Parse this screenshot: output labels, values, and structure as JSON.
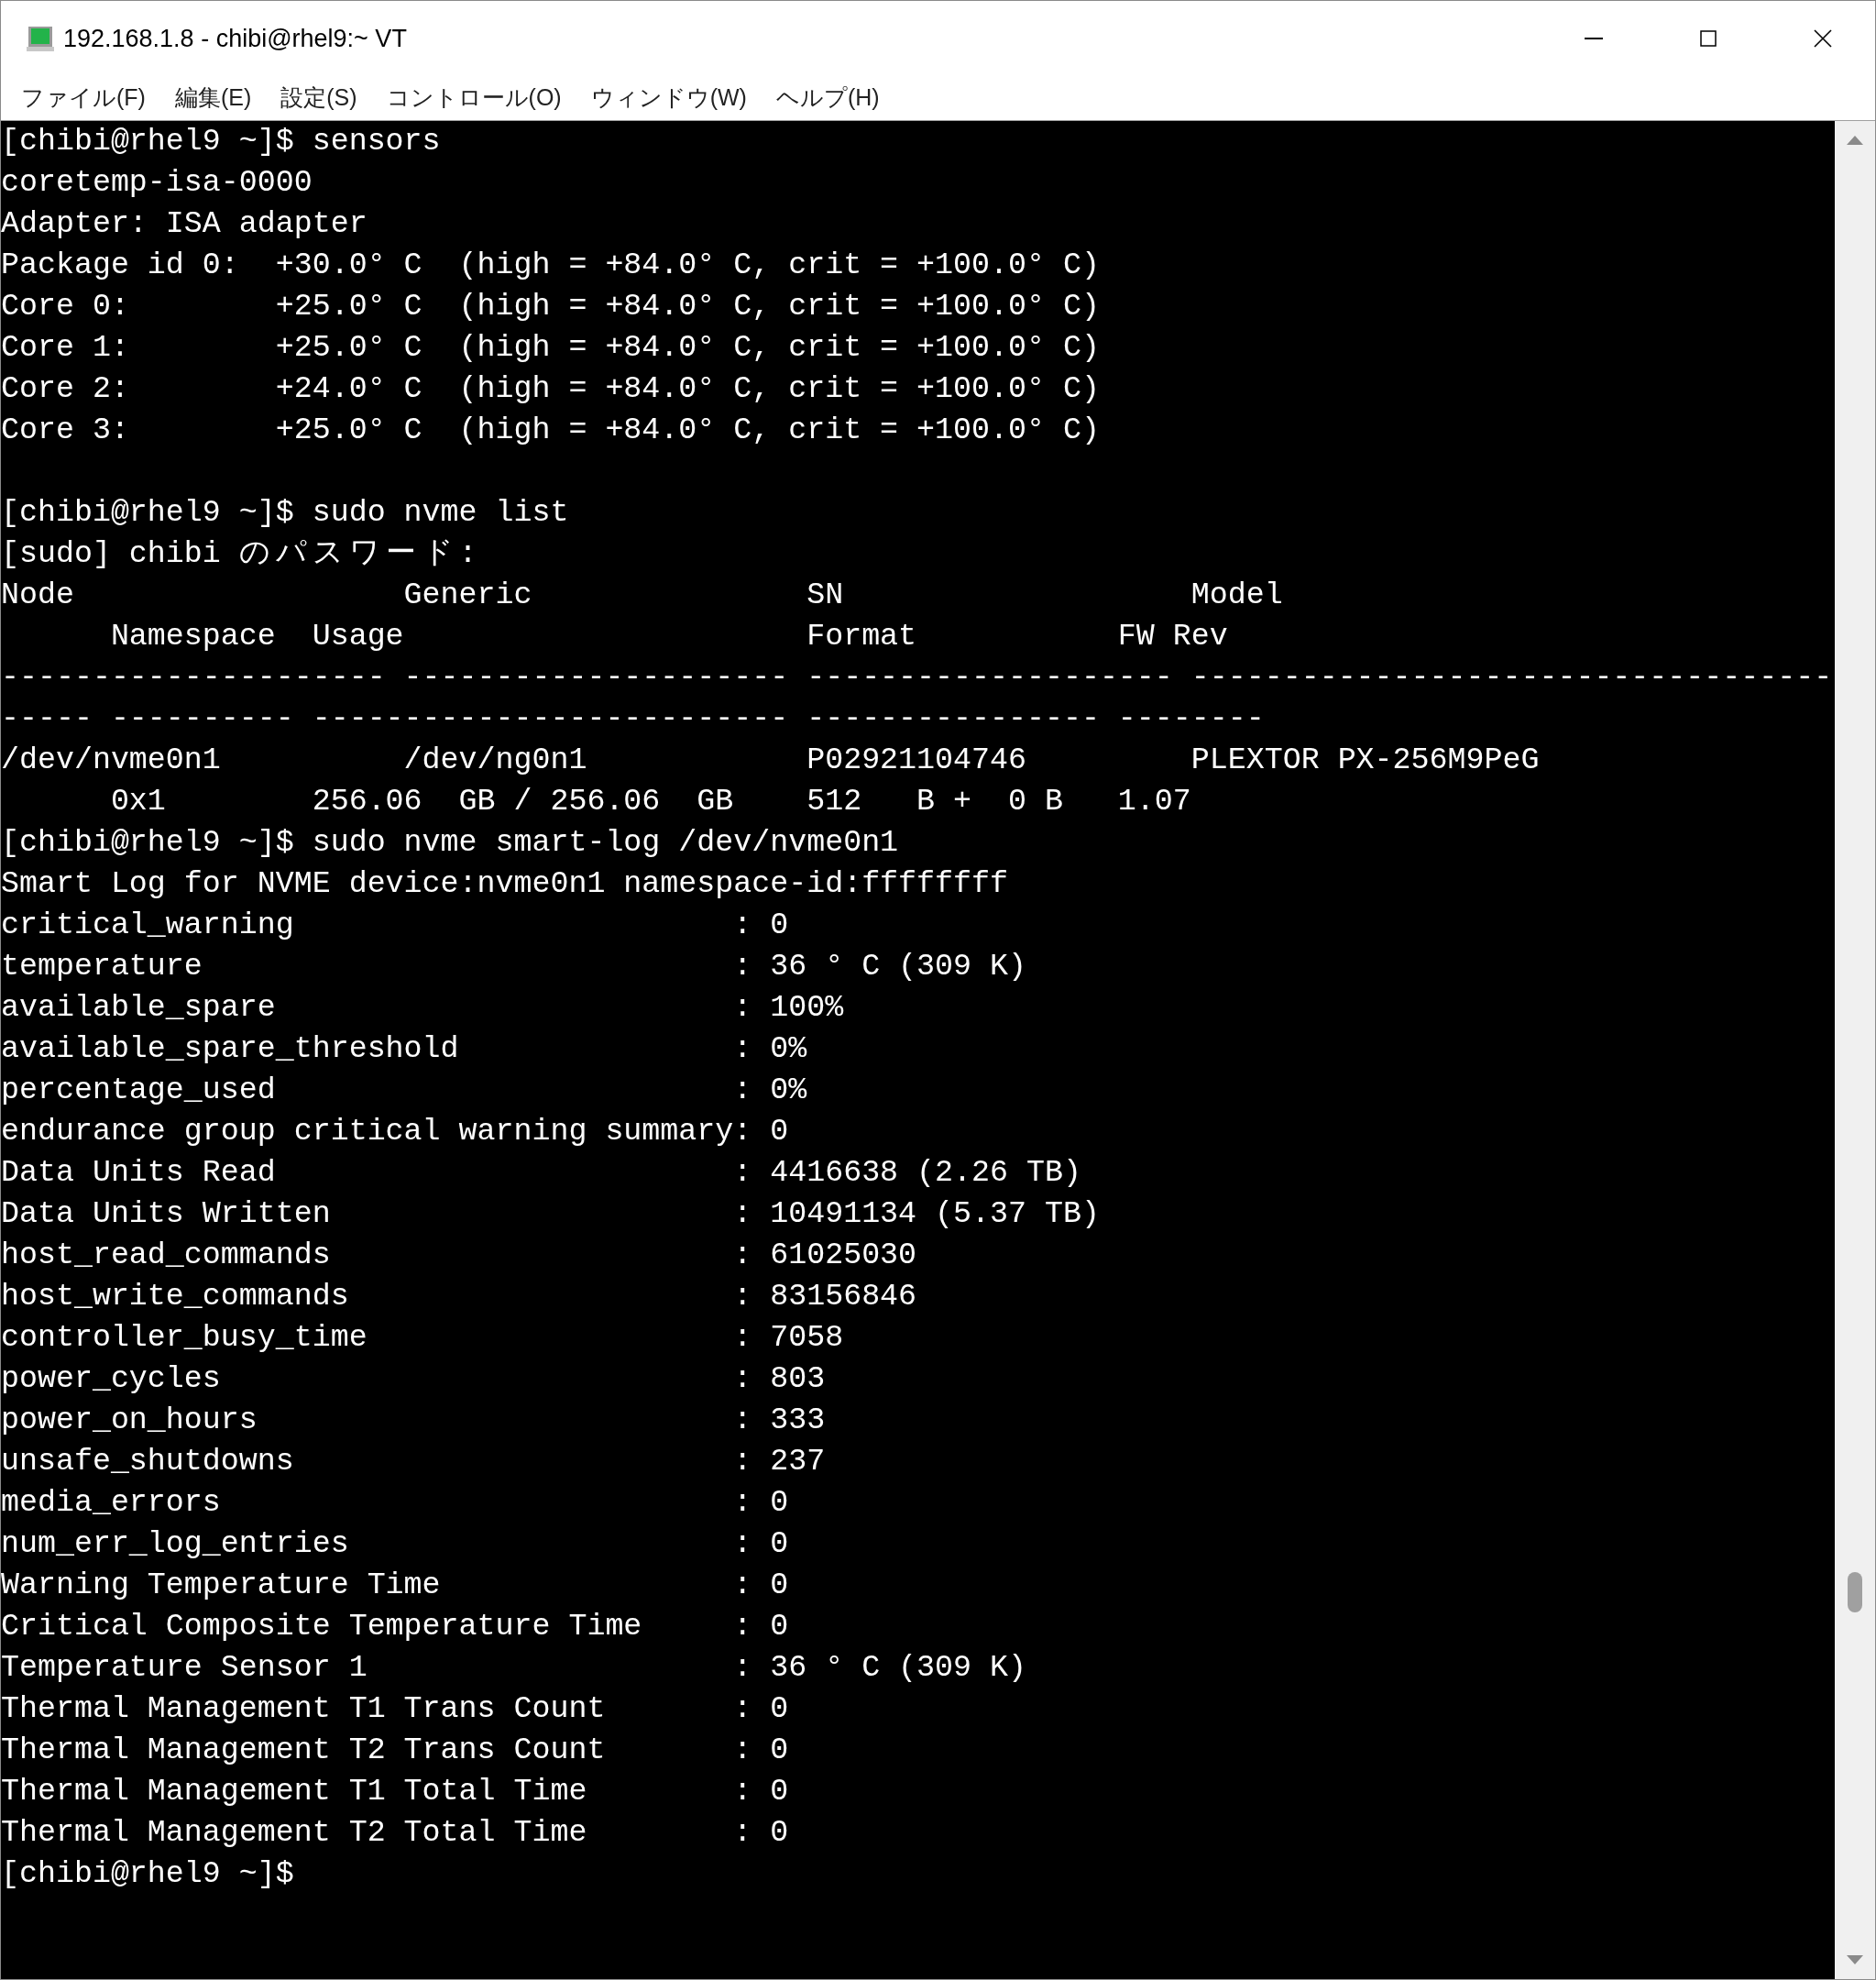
{
  "window": {
    "title": "192.168.1.8 - chibi@rhel9:~ VT"
  },
  "menu": [
    "ファイル(F)",
    "編集(E)",
    "設定(S)",
    "コントロール(O)",
    "ウィンドウ(W)",
    "ヘルプ(H)"
  ],
  "terminal": {
    "blocks": [
      [
        "[chibi@rhel9 ~]$ sensors",
        "coretemp-isa-0000",
        "Adapter: ISA adapter",
        "Package id 0:  +30.0° C  (high = +84.0° C, crit = +100.0° C)",
        "Core 0:        +25.0° C  (high = +84.0° C, crit = +100.0° C)",
        "Core 1:        +25.0° C  (high = +84.0° C, crit = +100.0° C)",
        "Core 2:        +24.0° C  (high = +84.0° C, crit = +100.0° C)",
        "Core 3:        +25.0° C  (high = +84.0° C, crit = +100.0° C)"
      ],
      [
        "[chibi@rhel9 ~]$ sudo nvme list",
        "[sudo] chibi のパスワード:",
        "Node                  Generic               SN                   Model",
        "      Namespace  Usage                      Format           FW Rev",
        "--------------------- --------------------- -------------------- -----------------------------------",
        "----- ---------- -------------------------- ---------------- --------",
        "/dev/nvme0n1          /dev/ng0n1            P02921104746         PLEXTOR PX-256M9PeG",
        "      0x1        256.06  GB / 256.06  GB    512   B +  0 B   1.07",
        "[chibi@rhel9 ~]$ sudo nvme smart-log /dev/nvme0n1",
        "Smart Log for NVME device:nvme0n1 namespace-id:ffffffff",
        "critical_warning                        : 0",
        "temperature                             : 36 ° C (309 K)",
        "available_spare                         : 100%",
        "available_spare_threshold               : 0%",
        "percentage_used                         : 0%",
        "endurance group critical warning summary: 0",
        "Data Units Read                         : 4416638 (2.26 TB)",
        "Data Units Written                      : 10491134 (5.37 TB)",
        "host_read_commands                      : 61025030",
        "host_write_commands                     : 83156846",
        "controller_busy_time                    : 7058",
        "power_cycles                            : 803",
        "power_on_hours                          : 333",
        "unsafe_shutdowns                        : 237",
        "media_errors                            : 0",
        "num_err_log_entries                     : 0",
        "Warning Temperature Time                : 0",
        "Critical Composite Temperature Time     : 0",
        "Temperature Sensor 1                    : 36 ° C (309 K)",
        "Thermal Management T1 Trans Count       : 0",
        "Thermal Management T2 Trans Count       : 0",
        "Thermal Management T1 Total Time        : 0",
        "Thermal Management T2 Total Time        : 0",
        "[chibi@rhel9 ~]$"
      ]
    ]
  }
}
